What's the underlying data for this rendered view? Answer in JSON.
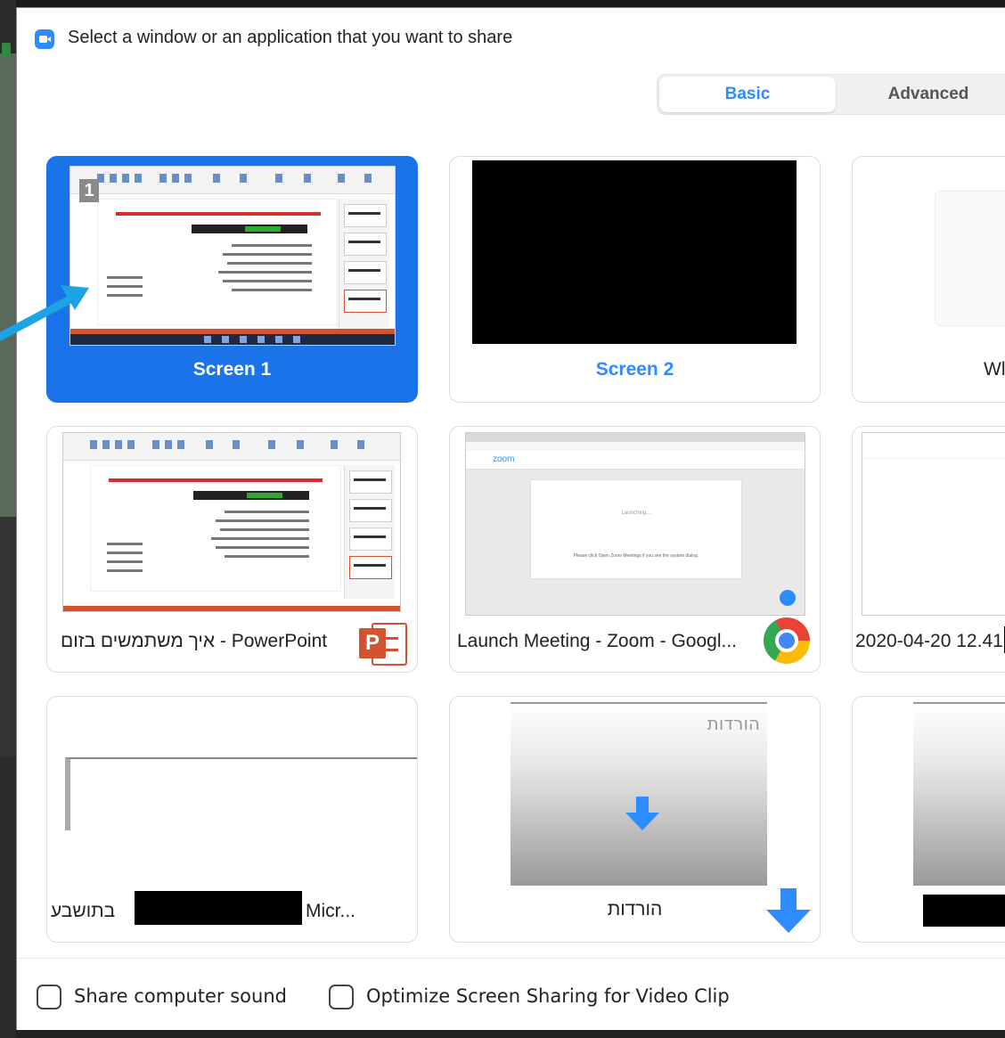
{
  "dialog": {
    "title": "Select a window or an application that you want to share"
  },
  "tabs": {
    "basic": "Basic",
    "advanced": "Advanced",
    "selected": "Basic"
  },
  "tiles": [
    {
      "label": "Screen 1",
      "selected": true,
      "badge": "1"
    },
    {
      "label": "Screen 2",
      "selected": false
    },
    {
      "label": "Wl",
      "selected": false
    },
    {
      "label": "איך משתמשים בזום - PowerPoint",
      "app_icon": "powerpoint-icon"
    },
    {
      "label": "Launch Meeting - Zoom - Googl...",
      "app_icon": "chrome-icon"
    },
    {
      "label": "2020-04-20 12.41",
      "app_icon": "file-explorer-icon"
    },
    {
      "label_left": "בתושבע",
      "label_right": "Micr...",
      "redacted": true
    },
    {
      "label": "הורדות",
      "thumb_text": "הורדות",
      "app_icon": "download-arrow-icon"
    },
    {
      "label": "",
      "redacted": true
    }
  ],
  "chrome_thumb": {
    "logo": "zoom",
    "loading": "Launching...",
    "message": "Please click Open Zoom Meetings if you see the system dialog."
  },
  "footer": {
    "share_sound": "Share computer sound",
    "share_sound_checked": false,
    "optimize_video": "Optimize Screen Sharing for Video Clip",
    "optimize_video_checked": false
  },
  "colors": {
    "accent": "#2D8CFF",
    "selected_tile": "#1A73E8",
    "annotation_arrow": "#1CA3E3"
  }
}
